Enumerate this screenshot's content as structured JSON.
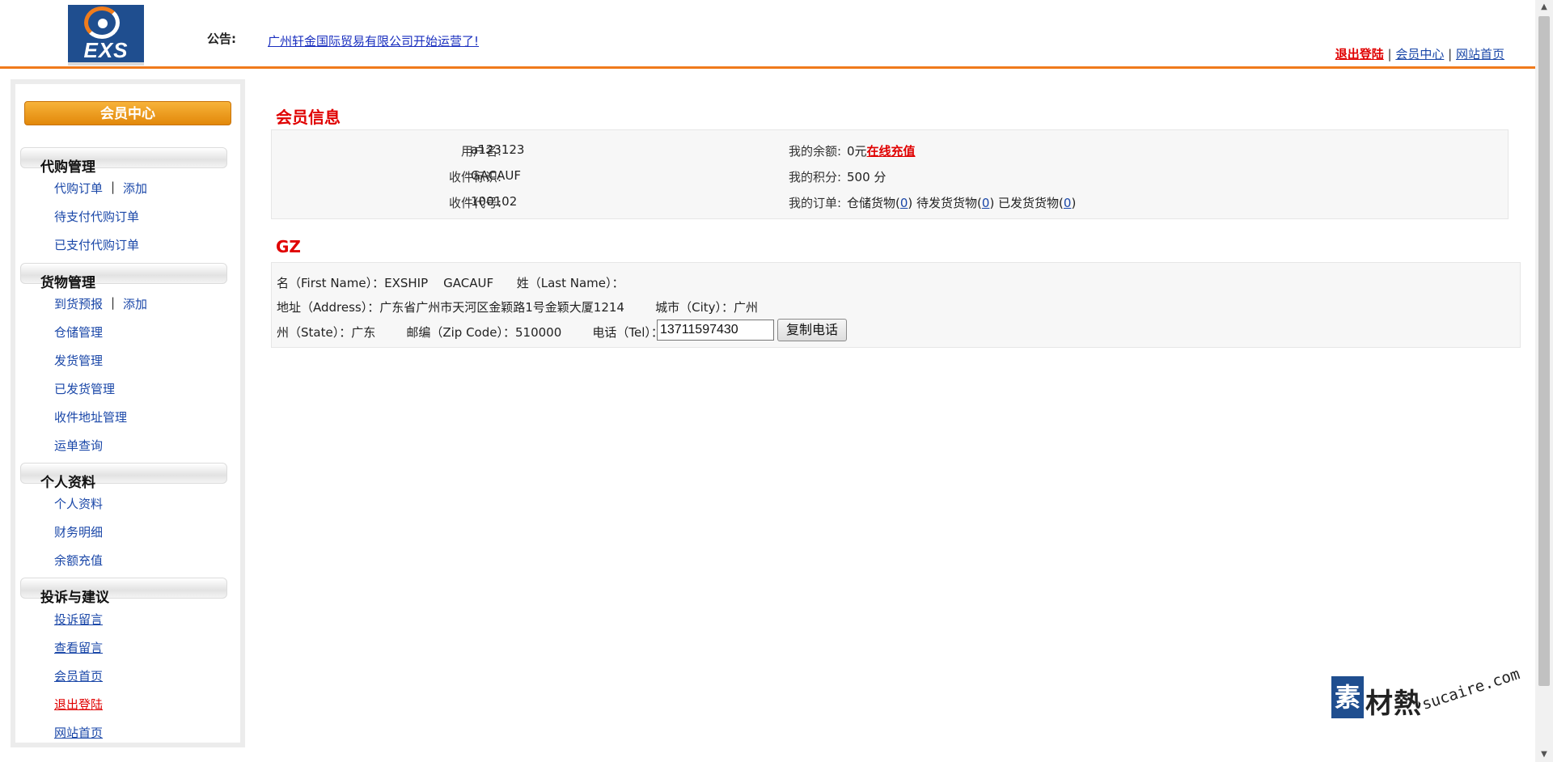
{
  "header": {
    "logo_text": "EXS",
    "notice_label": "公告:",
    "notice_text": "广州轩金国际贸易有限公司开始运营了!",
    "top_links": {
      "logout": "退出登陆",
      "member_center": "会员中心",
      "site_home": "网站首页",
      "sep": "|"
    }
  },
  "sidebar": {
    "member_button": "会员中心",
    "sections": [
      {
        "title": "代购管理",
        "items": [
          "代购订单",
          "添加",
          "待支付代购订单",
          "已支付代购订单"
        ]
      },
      {
        "title": "货物管理",
        "items": [
          "到货预报",
          "添加",
          "仓储管理",
          "发货管理",
          "已发货管理",
          "收件地址管理",
          "运单查询"
        ]
      },
      {
        "title": "个人资料",
        "items": [
          "个人资料",
          "财务明细",
          "余额充值"
        ]
      },
      {
        "title": "投诉与建议",
        "items": [
          "投诉留言",
          "查看留言",
          "会员首页",
          "退出登陆",
          "网站首页"
        ]
      }
    ],
    "sep": "|"
  },
  "member_info": {
    "title": "会员信息",
    "username_label": "用户名:",
    "username": "a123123",
    "recipient_tag_label": "收件标识:",
    "recipient_tag": "GACAUF",
    "recipient_code_label": "收件代号:",
    "recipient_code": "100102",
    "balance_label": "我的余额:",
    "balance": "0元",
    "recharge_link": "在线充值",
    "points_label": "我的积分:",
    "points": "500 分",
    "orders_label": "我的订单:",
    "orders_storage": "仓储货物(",
    "orders_storage_count": "0",
    "orders_pending": ") 待发货货物(",
    "orders_pending_count": "0",
    "orders_shipped": ") 已发货货物(",
    "orders_shipped_count": "0",
    "orders_close": ")"
  },
  "address": {
    "title": "GZ",
    "line1": "名（First Name）：EXSHIP    GACAUF      姓（Last Name）：",
    "line2": "地址（Address）：广东省广州市天河区金颖路1号金颖大厦1214        城市（City）：广州",
    "line3": "州（State）：广东        邮编（Zip Code）：510000        电话（Tel）：",
    "tel": "13711597430",
    "copy_button": "复制电话"
  },
  "watermark": {
    "square": "素",
    "cn": "材熱",
    "en": "sucaire.com"
  }
}
